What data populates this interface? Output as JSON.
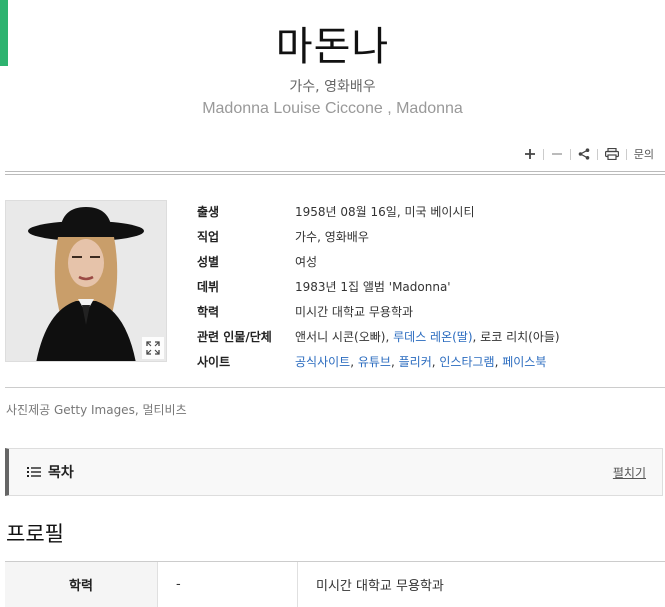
{
  "accent_color": "#2db36f",
  "link_color": "#2a6bbf",
  "header": {
    "title": "마돈나",
    "subtitle": "가수, 영화배우",
    "original_name": "Madonna Louise Ciccone , Madonna"
  },
  "toolbar": {
    "zoom_in_icon": "plus-icon",
    "zoom_out_icon": "minus-icon",
    "share_icon": "share-icon",
    "print_icon": "print-icon",
    "inquiry_label": "문의"
  },
  "info": {
    "birth_key": "출생",
    "birth_val": "1958년 08월 16일, 미국 베이시티",
    "job_key": "직업",
    "job_val": "가수, 영화배우",
    "gender_key": "성별",
    "gender_val": "여성",
    "debut_key": "데뷔",
    "debut_val": "1983년 1집 앨범 'Madonna'",
    "edu_key": "학력",
    "edu_val": "미시간 대학교 무용학과",
    "related_key": "관련 인물/단체",
    "related_1": "앤서니 시콘(오빠)",
    "related_sep1": ", ",
    "related_2": "루데스 레온(딸)",
    "related_sep2": ", ",
    "related_3": "로코 리치(아들)",
    "sites_key": "사이트",
    "sites": [
      "공식사이트",
      "유튜브",
      "플리커",
      "인스타그램",
      "페이스북"
    ],
    "sites_sep": ", "
  },
  "photo_credit": "사진제공  Getty Images, 멀티비츠",
  "toc": {
    "label": "목차",
    "toggle_label": "펼치기"
  },
  "profile": {
    "section_title": "프로필",
    "row_key": "학력",
    "row_sub": "-",
    "row_val": "미시간 대학교 무용학과"
  }
}
